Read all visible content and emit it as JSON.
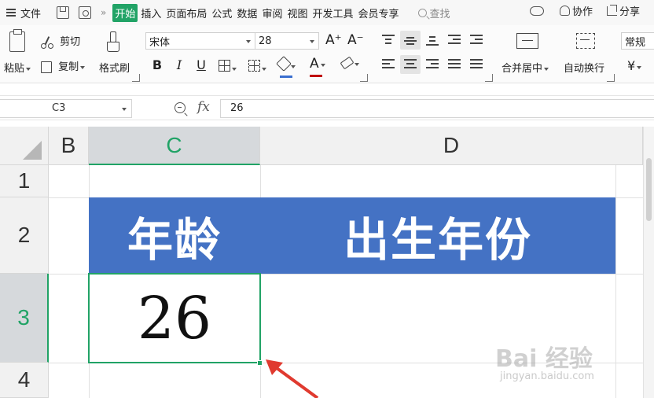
{
  "menubar": {
    "file_label": "文件",
    "more_glyph": "»",
    "tabs": [
      {
        "label": "开始",
        "active": true
      },
      {
        "label": "插入",
        "active": false
      },
      {
        "label": "页面布局",
        "active": false
      },
      {
        "label": "公式",
        "active": false
      },
      {
        "label": "数据",
        "active": false
      },
      {
        "label": "审阅",
        "active": false
      },
      {
        "label": "视图",
        "active": false
      },
      {
        "label": "开发工具",
        "active": false
      },
      {
        "label": "会员专享",
        "active": false
      }
    ],
    "search_label": "查找",
    "collab_label": "协作",
    "share_label": "分享"
  },
  "ribbon": {
    "paste_label": "粘贴",
    "cut_label": "剪切",
    "copy_label": "复制",
    "format_painter_label": "格式刷",
    "font_name": "宋体",
    "font_size": "28",
    "grow_font": "A⁺",
    "shrink_font": "A⁻",
    "bold": "B",
    "italic": "I",
    "underline": "U",
    "font_color_glyph": "A",
    "merge_center_label": "合并居中",
    "wrap_text_label": "自动换行",
    "number_format": "常规",
    "currency_glyph": "¥"
  },
  "formula_bar": {
    "name_box": "C3",
    "fx_label": "fx",
    "content": "26"
  },
  "grid": {
    "columns": [
      {
        "label": "B",
        "selected": false
      },
      {
        "label": "C",
        "selected": true
      },
      {
        "label": "D",
        "selected": false
      }
    ],
    "rows": [
      {
        "label": "1",
        "selected": false
      },
      {
        "label": "2",
        "selected": false
      },
      {
        "label": "3",
        "selected": true
      },
      {
        "label": "4",
        "selected": false
      }
    ],
    "cells": {
      "C2": "年龄",
      "D2": "出生年份",
      "C3": "26"
    },
    "header_fill": "#4472c4",
    "selection_color": "#21a366"
  },
  "watermark": {
    "text": "Bai 经验",
    "sub": "jingyan.baidu.com"
  }
}
